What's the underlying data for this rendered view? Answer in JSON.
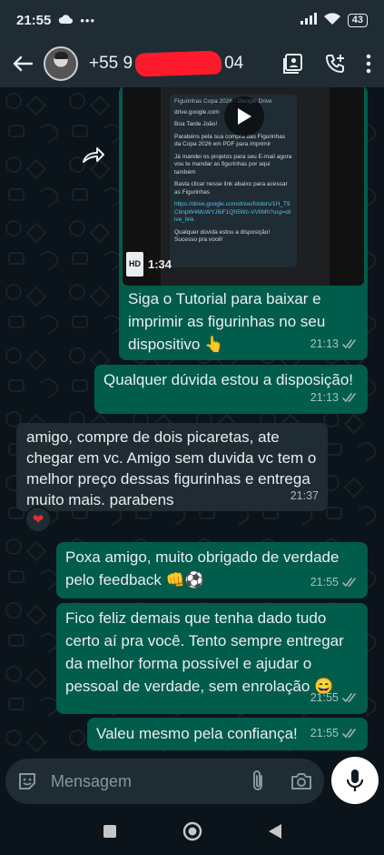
{
  "status_bar": {
    "time": "21:55",
    "battery": "43"
  },
  "header": {
    "phone_prefix": "+55 9",
    "phone_suffix": "04"
  },
  "video_message": {
    "duration": "1:34",
    "hd_label": "HD",
    "preview": {
      "title": "Figurinhas Copa 2026 - Google Drive",
      "lines": [
        "drive.google.com",
        "Boa Tarde João!",
        "Parabéns pela sua compra das Figurinhas da Copa 2026 em PDF para imprimir",
        "Já mandei os projetos para seu E-mail agora vou te mandar as figurinhas por aqui também",
        "Basta clicar nesse link abaixo para acessar as Figurinhas",
        "Qualquer dúvida estou a disposição! Sucesso pra você!"
      ],
      "link": "https://drive.google.com/drive/folders/1H_T9C6npW4McWYJ6iF1Qh5Wc-VVlIMh?usp=drive_link"
    }
  },
  "messages": [
    {
      "direction": "out",
      "text": "Siga o Tutorial para baixar e imprimir as figurinhas no seu dispositivo 👆",
      "time": "21:13"
    },
    {
      "direction": "out",
      "text": "Qualquer dúvida estou a disposição!",
      "time": "21:13"
    },
    {
      "direction": "in",
      "text": "amigo, compre de dois picaretas, ate chegar em vc. Amigo sem duvida vc tem o melhor preço dessas figurinhas e entrega muito mais. parabens",
      "time": "21:37",
      "reaction": "❤"
    },
    {
      "direction": "out",
      "text": "Poxa amigo, muito obrigado de verdade pelo feedback 👊⚽",
      "time": "21:55"
    },
    {
      "direction": "out",
      "text": "Fico feliz demais que tenha dado tudo certo aí pra você. Tento sempre entregar da melhor forma possível e ajudar o pessoal de verdade, sem enrolação 😄",
      "time": "21:55"
    },
    {
      "direction": "out",
      "text": "Valeu mesmo pela confiança!",
      "time": "21:55"
    }
  ],
  "composer": {
    "placeholder": "Mensagem"
  },
  "colors": {
    "outgoing_bubble": "#005c4b",
    "incoming_bubble": "#202c33",
    "background": "#0b141a",
    "read_tick": "#e9edef"
  }
}
